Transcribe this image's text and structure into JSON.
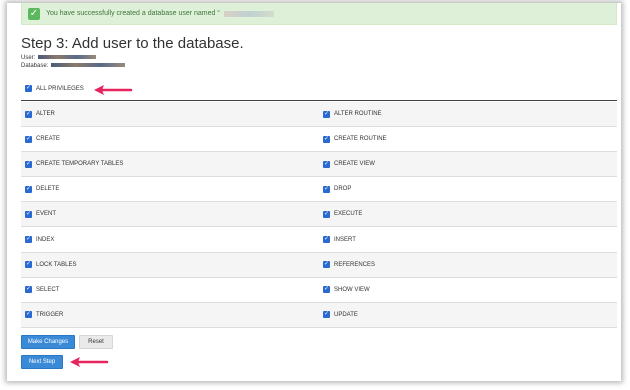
{
  "notice": {
    "message": "You have successfully created a database user named “",
    "icon": "checkmark-icon"
  },
  "page": {
    "title": "Step 3: Add user to the database.",
    "user_label": "User:",
    "database_label": "Database:"
  },
  "all_privileges": {
    "label": "ALL PRIVILEGES",
    "checked": true
  },
  "privileges": [
    [
      "ALTER",
      "ALTER ROUTINE"
    ],
    [
      "CREATE",
      "CREATE ROUTINE"
    ],
    [
      "CREATE TEMPORARY TABLES",
      "CREATE VIEW"
    ],
    [
      "DELETE",
      "DROP"
    ],
    [
      "EVENT",
      "EXECUTE"
    ],
    [
      "INDEX",
      "INSERT"
    ],
    [
      "LOCK TABLES",
      "REFERENCES"
    ],
    [
      "SELECT",
      "SHOW VIEW"
    ],
    [
      "TRIGGER",
      "UPDATE"
    ]
  ],
  "buttons": {
    "make_changes": "Make Changes",
    "reset": "Reset",
    "next_step": "Next Step"
  },
  "colors": {
    "accent": "#3a8ad8",
    "arrow": "#e8245c",
    "success_bg": "#dff0d8",
    "checkbox": "#2a6ad0"
  }
}
